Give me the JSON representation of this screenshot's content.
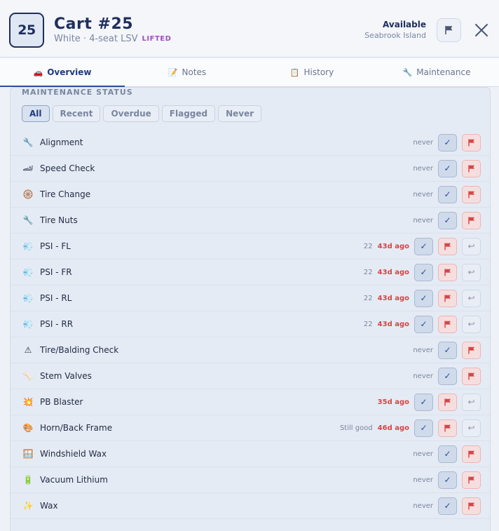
{
  "header": {
    "badge_number": "25",
    "title": "Cart #25",
    "subtitle": "White · 4-seat LSV",
    "tag": "LIFTED",
    "status": "Available",
    "location": "Seabrook Island"
  },
  "tabs": [
    {
      "label": "Overview",
      "icon": "car-icon"
    },
    {
      "label": "Notes",
      "icon": "notes-icon"
    },
    {
      "label": "History",
      "icon": "clipboard-icon"
    },
    {
      "label": "Maintenance",
      "icon": "wrench-icon"
    }
  ],
  "section_title": "MAINTENANCE STATUS",
  "filters": [
    "All",
    "Recent",
    "Overdue",
    "Flagged",
    "Never"
  ],
  "rows": [
    {
      "label": "Alignment",
      "icon": "wrench-icon",
      "glyph": "🔧",
      "psi": "",
      "note": "",
      "status": "never",
      "overdue": false,
      "undo": false
    },
    {
      "label": "Speed Check",
      "icon": "speed-icon",
      "glyph": "🏎",
      "psi": "",
      "note": "",
      "status": "never",
      "overdue": false,
      "undo": false
    },
    {
      "label": "Tire Change",
      "icon": "tire-icon",
      "glyph": "🛞",
      "psi": "",
      "note": "",
      "status": "never",
      "overdue": false,
      "undo": false
    },
    {
      "label": "Tire Nuts",
      "icon": "wrench-icon",
      "glyph": "🔧",
      "psi": "",
      "note": "",
      "status": "never",
      "overdue": false,
      "undo": false
    },
    {
      "label": "PSI - FL",
      "icon": "pressure-icon",
      "glyph": "💨",
      "psi": "22",
      "note": "",
      "status": "43d ago",
      "overdue": true,
      "undo": true
    },
    {
      "label": "PSI - FR",
      "icon": "pressure-icon",
      "glyph": "💨",
      "psi": "22",
      "note": "",
      "status": "43d ago",
      "overdue": true,
      "undo": true
    },
    {
      "label": "PSI - RL",
      "icon": "pressure-icon",
      "glyph": "💨",
      "psi": "22",
      "note": "",
      "status": "43d ago",
      "overdue": true,
      "undo": true
    },
    {
      "label": "PSI - RR",
      "icon": "pressure-icon",
      "glyph": "💨",
      "psi": "22",
      "note": "",
      "status": "43d ago",
      "overdue": true,
      "undo": true
    },
    {
      "label": "Tire/Balding Check",
      "icon": "warning-icon",
      "glyph": "⚠",
      "psi": "",
      "note": "",
      "status": "never",
      "overdue": false,
      "undo": false
    },
    {
      "label": "Stem Valves",
      "icon": "bone-icon",
      "glyph": "🦴",
      "psi": "",
      "note": "",
      "status": "never",
      "overdue": false,
      "undo": false
    },
    {
      "label": "PB Blaster",
      "icon": "burst-icon",
      "glyph": "💥",
      "psi": "",
      "note": "",
      "status": "35d ago",
      "overdue": true,
      "undo": true
    },
    {
      "label": "Horn/Back Frame",
      "icon": "palette-icon",
      "glyph": "🎨",
      "psi": "",
      "note": "Still good",
      "status": "46d ago",
      "overdue": true,
      "undo": true
    },
    {
      "label": "Windshield Wax",
      "icon": "window-icon",
      "glyph": "🪟",
      "psi": "",
      "note": "",
      "status": "never",
      "overdue": false,
      "undo": false
    },
    {
      "label": "Vacuum Lithium",
      "icon": "battery-icon",
      "glyph": "🔋",
      "psi": "",
      "note": "",
      "status": "never",
      "overdue": false,
      "undo": false
    },
    {
      "label": "Wax",
      "icon": "sparkles-icon",
      "glyph": "✨",
      "psi": "",
      "note": "",
      "status": "never",
      "overdue": false,
      "undo": false
    }
  ],
  "colors": {
    "accent": "#2b4d9b",
    "overdue": "#d64545",
    "tag": "#a24fc0"
  }
}
